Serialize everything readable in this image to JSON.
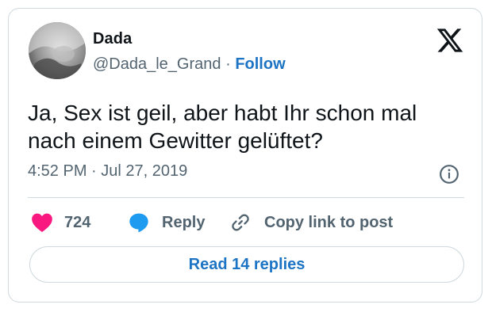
{
  "author": {
    "name": "Dada",
    "handle": "@Dada_le_Grand",
    "separator": "·",
    "follow_label": "Follow"
  },
  "tweet": {
    "text": "Ja, Sex ist geil, aber habt Ihr schon mal nach einem Gewitter gelüftet?"
  },
  "meta": {
    "time": "4:52 PM",
    "separator": "·",
    "date": "Jul 27, 2019"
  },
  "actions": {
    "likes": "724",
    "reply_label": "Reply",
    "copy_label": "Copy link to post"
  },
  "footer": {
    "read_replies_label": "Read 14 replies"
  },
  "icons": {
    "logo": "x-logo-icon",
    "info": "info-icon",
    "like": "heart-icon",
    "reply": "speech-bubble-icon",
    "copy": "link-icon"
  },
  "colors": {
    "link": "#1d74c4",
    "like": "#f91880",
    "reply": "#1d9bf0",
    "muted": "#536471",
    "border": "#cfd9de"
  }
}
